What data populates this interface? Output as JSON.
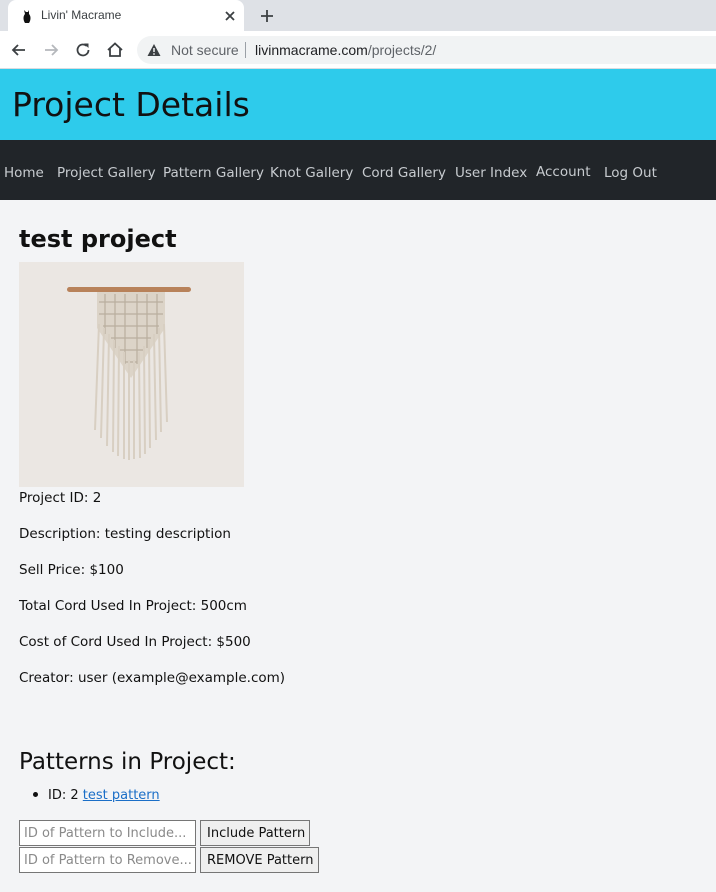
{
  "browser": {
    "tab_title": "Livin' Macrame",
    "security_label": "Not secure",
    "url_host": "livinmacrame.com",
    "url_path": "/projects/2/"
  },
  "header": {
    "title": "Project Details"
  },
  "nav": {
    "items": [
      "Home",
      "Project Gallery",
      "Pattern Gallery",
      "Knot Gallery",
      "Cord Gallery",
      "User Index",
      "Account",
      "Log Out"
    ]
  },
  "project": {
    "title": "test project",
    "image_subject": "macrame wall hanging",
    "details": [
      "Project ID: 2",
      "Description: testing description",
      "Sell Price: $100",
      "Total Cord Used In Project: 500cm",
      "Cost of Cord Used In Project: $500",
      "Creator: user (example@example.com)"
    ]
  },
  "patterns": {
    "heading": "Patterns in Project:",
    "items": [
      {
        "id_label": "ID: 2",
        "link_text": "test pattern"
      }
    ],
    "include_placeholder": "ID of Pattern to Include...",
    "include_button": "Include Pattern",
    "remove_placeholder": "ID of Pattern to Remove...",
    "remove_button": "REMOVE Pattern"
  },
  "colors": {
    "header_bg": "#2ecbeb",
    "navbar_bg": "#212529",
    "nav_text": "#c7cbcf",
    "link": "#1a6ec7",
    "page_bg": "#f3f4f6"
  }
}
